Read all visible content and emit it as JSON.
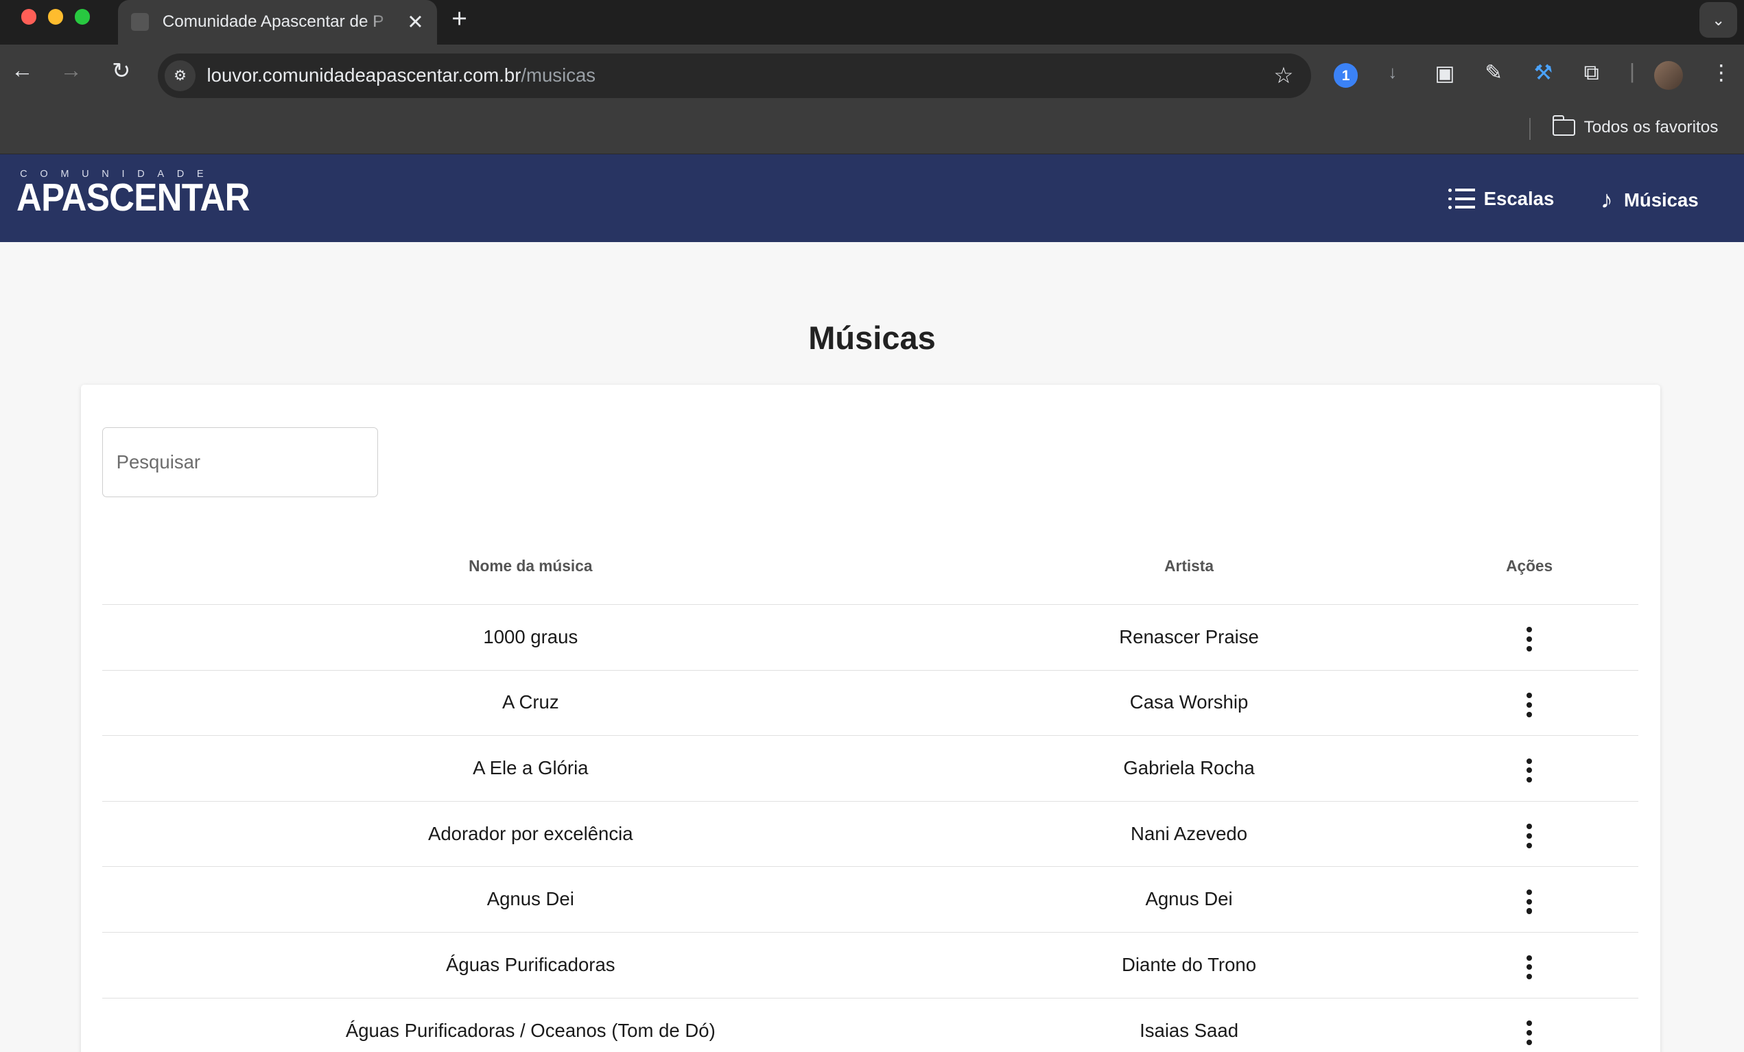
{
  "browser": {
    "tab_title": "Comunidade Apascentar de P",
    "url_host": "louvor.comunidadeapascentar.com.br",
    "url_path": "/musicas",
    "bookmarks_folder": "Todos os favoritos",
    "icons": [
      "back-icon",
      "forward-icon",
      "reload-icon",
      "site-info-icon",
      "star-icon",
      "onepassword-icon",
      "download-icon",
      "picture-in-picture-icon",
      "eyedropper-icon",
      "hammer-icon",
      "extensions-icon",
      "profile-avatar",
      "kebab-menu-icon"
    ]
  },
  "header": {
    "logo_top": "COMUNIDADE",
    "logo_main": "APASCENTAR",
    "nav": [
      {
        "label": "Escalas",
        "icon": "list-icon"
      },
      {
        "label": "Músicas",
        "icon": "music-note-icon"
      }
    ],
    "bg_color": "#283462"
  },
  "page": {
    "title": "Músicas",
    "search_placeholder": "Pesquisar"
  },
  "table": {
    "columns": [
      "Nome da música",
      "Artista",
      "Ações"
    ],
    "rows": [
      {
        "name": "1000 graus",
        "artist": "Renascer Praise"
      },
      {
        "name": "A Cruz",
        "artist": "Casa Worship"
      },
      {
        "name": "A Ele a Glória",
        "artist": "Gabriela Rocha"
      },
      {
        "name": "Adorador por excelência",
        "artist": "Nani Azevedo"
      },
      {
        "name": "Agnus Dei",
        "artist": "Agnus Dei"
      },
      {
        "name": "Águas Purificadoras",
        "artist": "Diante do Trono"
      },
      {
        "name": "Águas Purificadoras / Oceanos (Tom de Dó)",
        "artist": "Isaias Saad"
      }
    ]
  }
}
